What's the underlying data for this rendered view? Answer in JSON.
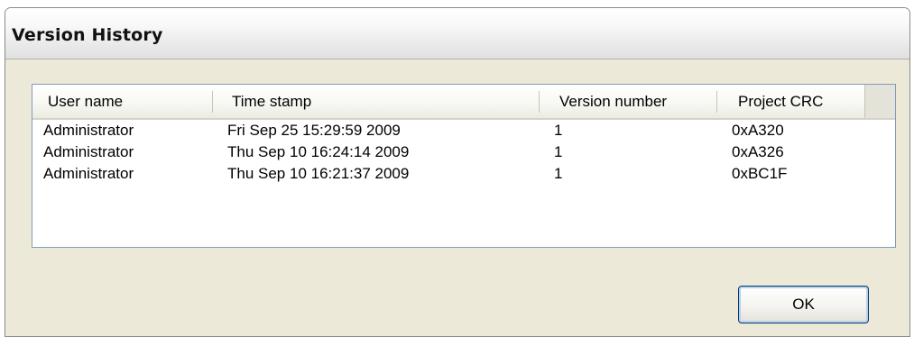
{
  "window": {
    "title": "Version History"
  },
  "list": {
    "columns": [
      "User name",
      "Time stamp",
      "Version number",
      "Project CRC"
    ],
    "rows": [
      {
        "user": "Administrator",
        "timestamp": "Fri Sep 25 15:29:59 2009",
        "version": "1",
        "crc": "0xA320"
      },
      {
        "user": "Administrator",
        "timestamp": "Thu Sep 10 16:24:14 2009",
        "version": "1",
        "crc": "0xA326"
      },
      {
        "user": "Administrator",
        "timestamp": "Thu Sep 10 16:21:37 2009",
        "version": "1",
        "crc": "0xBC1F"
      }
    ]
  },
  "buttons": {
    "ok_label": "OK"
  }
}
